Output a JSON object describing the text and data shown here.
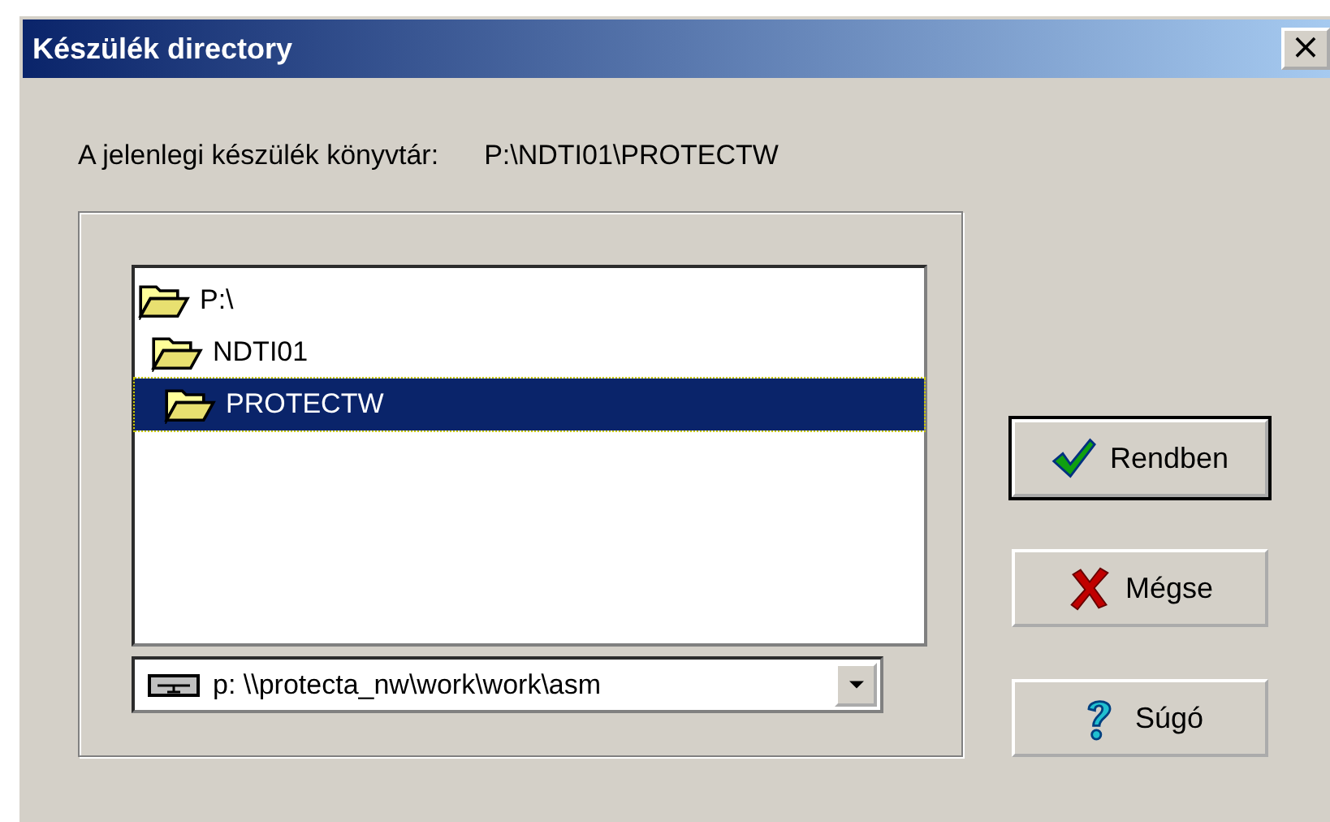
{
  "window": {
    "title": "Készülék directory",
    "close": "×"
  },
  "current_label": "A jelenlegi készülék könyvtár:",
  "current_path": "P:\\NDTI01\\PROTECTW",
  "tree": [
    {
      "label": "P:\\",
      "selected": false,
      "children": [
        {
          "label": "NDTI01",
          "selected": false,
          "children": [
            {
              "label": "PROTECTW",
              "selected": true
            }
          ]
        }
      ]
    }
  ],
  "drive": {
    "value": "p: \\\\protecta_nw\\work\\work\\asm"
  },
  "buttons": [
    {
      "label": "Rendben",
      "kind": "ok",
      "default": true
    },
    {
      "label": "Mégse",
      "kind": "cancel",
      "default": false
    },
    {
      "label": "Súgó",
      "kind": "help",
      "default": false
    }
  ]
}
